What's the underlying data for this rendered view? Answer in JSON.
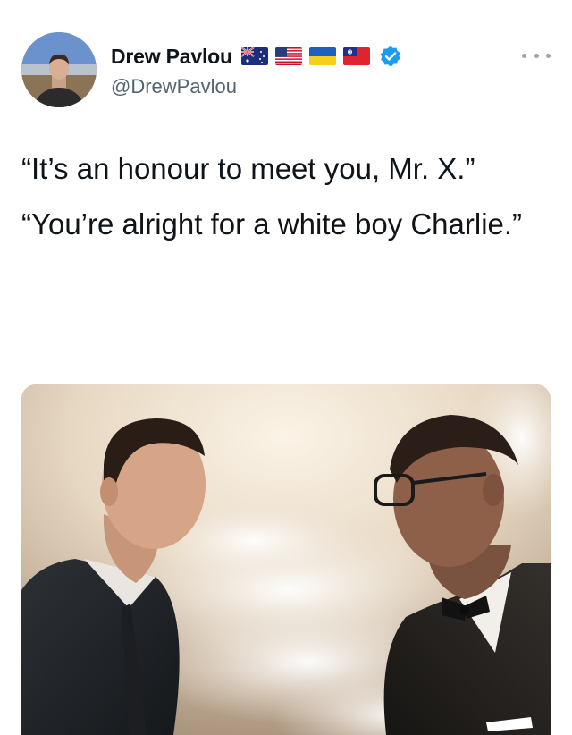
{
  "author": {
    "display_name": "Drew Pavlou",
    "handle": "@DrewPavlou",
    "avatar_icon": "avatar-photo",
    "flags": [
      "australia-flag-icon",
      "usa-flag-icon",
      "ukraine-flag-icon",
      "taiwan-flag-icon"
    ],
    "verified_icon": "verified-badge-icon",
    "verified_color": "#1d9bf0"
  },
  "menu": {
    "icon": "more-options-icon"
  },
  "tweet": {
    "lines": [
      "“It’s an honour to meet you, Mr. X.”",
      "“You’re alright for a white boy Charlie.”"
    ]
  },
  "media": {
    "type": "image",
    "icon": "photo-two-men-in-clouds"
  }
}
